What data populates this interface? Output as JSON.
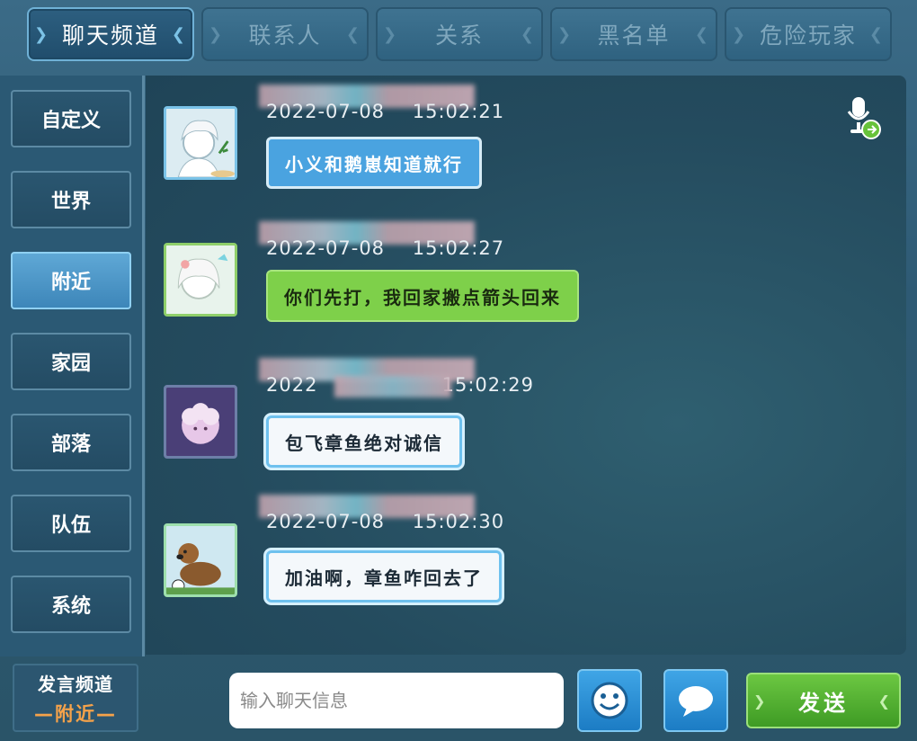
{
  "tabs": [
    {
      "label": "聊天频道",
      "active": true
    },
    {
      "label": "联系人",
      "active": false
    },
    {
      "label": "关系",
      "active": false
    },
    {
      "label": "黑名单",
      "active": false
    },
    {
      "label": "危险玩家",
      "active": false
    }
  ],
  "sidebar": {
    "items": [
      {
        "label": "自定义",
        "active": false
      },
      {
        "label": "世界",
        "active": false
      },
      {
        "label": "附近",
        "active": true
      },
      {
        "label": "家园",
        "active": false
      },
      {
        "label": "部落",
        "active": false
      },
      {
        "label": "队伍",
        "active": false
      },
      {
        "label": "系统",
        "active": false
      }
    ]
  },
  "messages": [
    {
      "time_date": "2022-07-08",
      "time_clock": "15:02:21",
      "text": "小义和鹅崽知道就行",
      "bubble_style": "blue",
      "avatar": "white-haired-boy-avatar"
    },
    {
      "time_date": "2022-07-08",
      "time_clock": "15:02:27",
      "text": "你们先打，我回家搬点箭头回来",
      "bubble_style": "green",
      "avatar": "white-haired-girl-avatar"
    },
    {
      "time_date": "2022",
      "time_clock": "15:02:29",
      "text": "包飞章鱼绝对诚信",
      "bubble_style": "white",
      "avatar": "pink-sheep-avatar"
    },
    {
      "time_date": "2022-07-08",
      "time_clock": "15:02:30",
      "text": "加油啊，章鱼咋回去了",
      "bubble_style": "white",
      "avatar": "brown-dog-avatar"
    }
  ],
  "bottom": {
    "channel_title": "发言频道",
    "channel_value": "—附近—",
    "input_placeholder": "输入聊天信息",
    "send_label": "发送"
  },
  "colors": {
    "accent_blue": "#4aa3e0",
    "accent_green": "#7ed04a",
    "active_channel": "#f5a24a"
  }
}
